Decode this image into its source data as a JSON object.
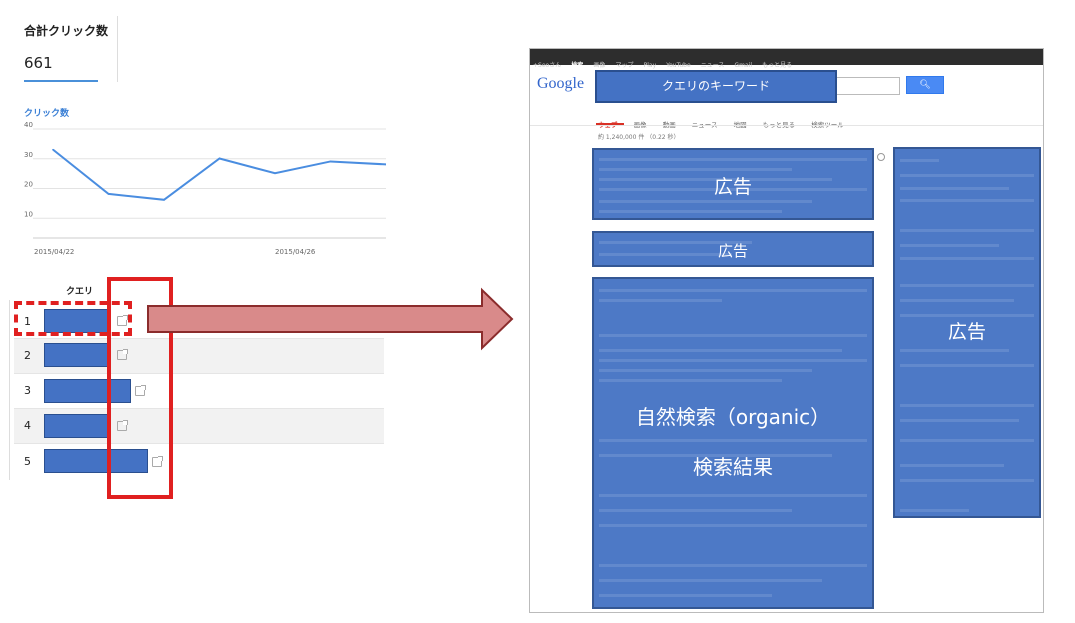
{
  "analytics": {
    "metric_title": "合計クリック数",
    "metric_value": "661",
    "chart_title": "クリック数",
    "query_header": "クエリ",
    "rows": [
      {
        "num": "1"
      },
      {
        "num": "2"
      },
      {
        "num": "3"
      },
      {
        "num": "4"
      },
      {
        "num": "5"
      }
    ]
  },
  "chart_data": {
    "type": "line",
    "title": "クリック数",
    "y_ticks": [
      "40",
      "30",
      "20",
      "10"
    ],
    "x_tick_labels": [
      "2015/04/22",
      "2015/04/26"
    ],
    "ylim": [
      0,
      40
    ],
    "values": [
      33,
      18,
      16,
      30,
      25,
      29,
      28
    ],
    "grid": true,
    "color": "#4a8de0"
  },
  "serp": {
    "topbar": [
      "+Seoさん",
      "検索",
      "画像",
      "マップ",
      "Play",
      "YouTube",
      "ニュース",
      "Gmail",
      "もっと見る"
    ],
    "logo": "Google",
    "search_box_label": "クエリのキーワード",
    "tabs": [
      "ウェブ",
      "画像",
      "動画",
      "ニュース",
      "地図",
      "もっと見る",
      "検索ツール"
    ],
    "result_count": "約 1,240,000 件 （0.22 秒）",
    "ad_top_label": "広告",
    "ad_mid_label": "広告",
    "ad_right_label": "広告",
    "organic_label_line1": "自然検索（organic）",
    "organic_label_line2": "検索結果"
  },
  "colors": {
    "highlight": "#e02020",
    "block": "#4472c4",
    "arrow": "#d98a8a"
  }
}
